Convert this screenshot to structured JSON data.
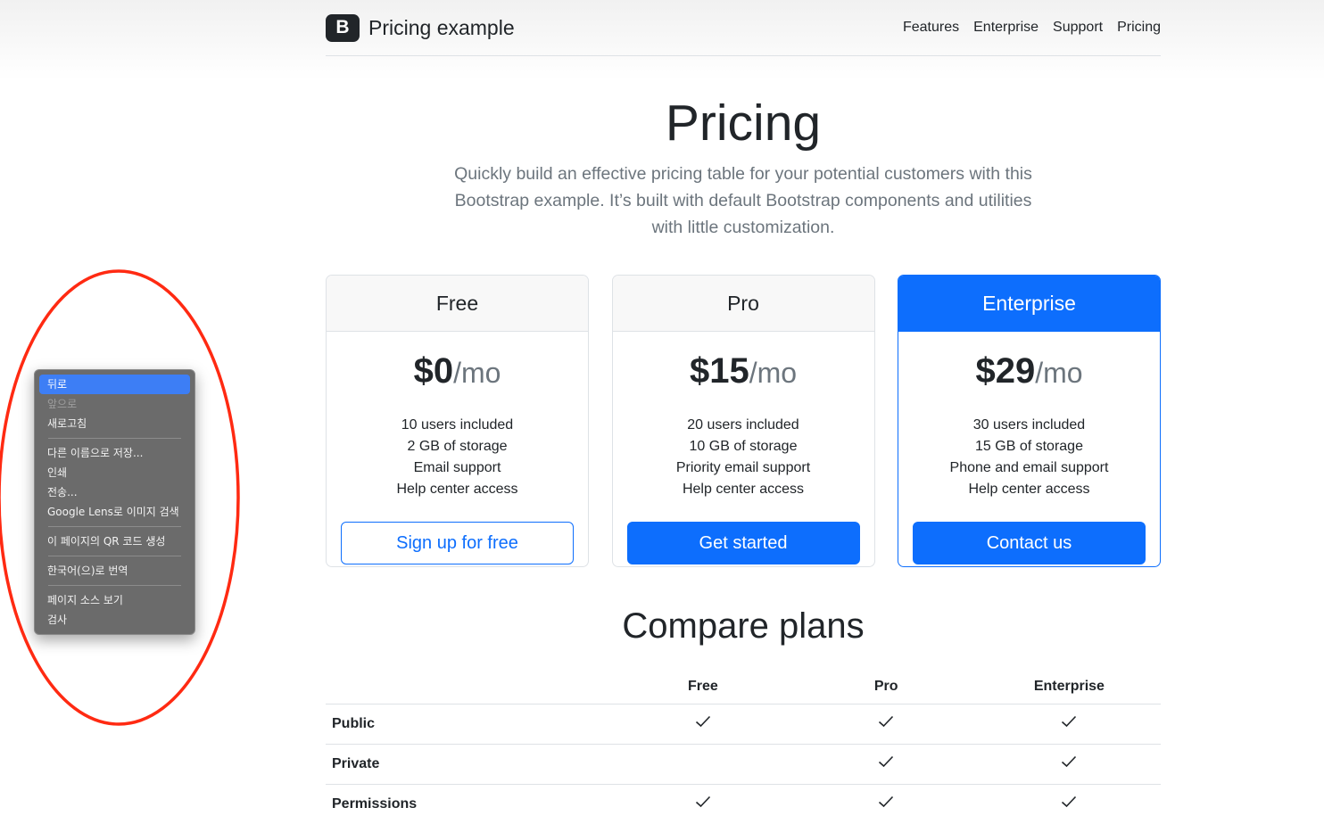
{
  "brand": {
    "logo_letter": "B",
    "name": "Pricing example"
  },
  "nav": [
    "Features",
    "Enterprise",
    "Support",
    "Pricing"
  ],
  "hero": {
    "title": "Pricing",
    "lead": "Quickly build an effective pricing table for your potential customers with this Bootstrap example. It’s built with default Bootstrap components and utilities with little customization."
  },
  "plans": [
    {
      "name": "Free",
      "price": "$0",
      "period": "/mo",
      "features": [
        "10 users included",
        "2 GB of storage",
        "Email support",
        "Help center access"
      ],
      "button": "Sign up for free"
    },
    {
      "name": "Pro",
      "price": "$15",
      "period": "/mo",
      "features": [
        "20 users included",
        "10 GB of storage",
        "Priority email support",
        "Help center access"
      ],
      "button": "Get started"
    },
    {
      "name": "Enterprise",
      "price": "$29",
      "period": "/mo",
      "features": [
        "30 users included",
        "15 GB of storage",
        "Phone and email support",
        "Help center access"
      ],
      "button": "Contact us"
    }
  ],
  "compare": {
    "title": "Compare plans",
    "columns": [
      "Free",
      "Pro",
      "Enterprise"
    ],
    "rows": [
      {
        "label": "Public",
        "checks": [
          true,
          true,
          true
        ]
      },
      {
        "label": "Private",
        "checks": [
          false,
          true,
          true
        ]
      },
      {
        "label": "Permissions",
        "checks": [
          true,
          true,
          true
        ]
      }
    ]
  },
  "context_menu": {
    "items": [
      "뒤로",
      "앞으로",
      "새로고침",
      "다른 이름으로 저장...",
      "인쇄",
      "전송...",
      "Google Lens로 이미지 검색",
      "이 페이지의 QR 코드 생성",
      "한국어(으)로 번역",
      "페이지 소스 보기",
      "검사"
    ]
  },
  "colors": {
    "primary": "#0d6efd",
    "annotation": "#ff2a12",
    "menu_bg": "#6b6b6b",
    "menu_highlight": "#3d7ef5"
  }
}
